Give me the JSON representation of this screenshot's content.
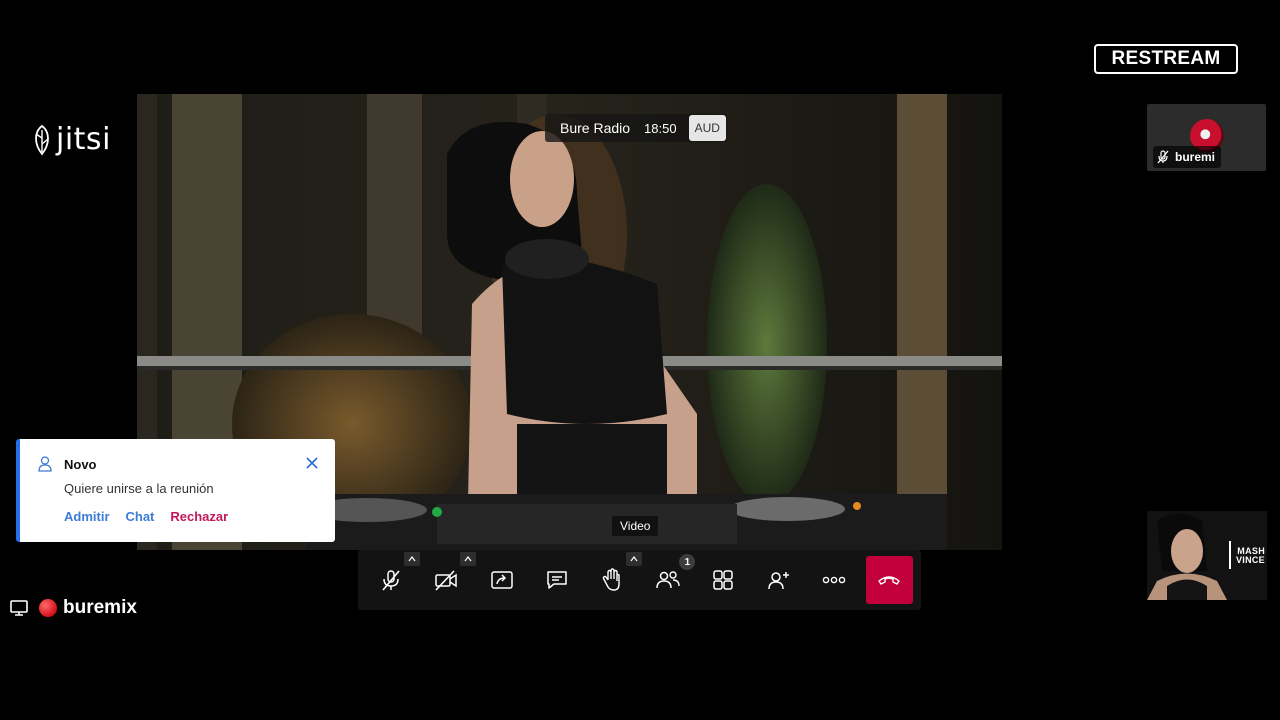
{
  "meeting": {
    "name": "Bure Radio",
    "time": "18:50",
    "audio_badge": "AUD"
  },
  "brand": {
    "jitsi_word": "jitsi",
    "restream": "RESTREAM"
  },
  "participants": {
    "buremi": {
      "name": "buremi",
      "muted": true
    },
    "vince": {
      "logo_line1": "MASH",
      "logo_line2": "VINCE"
    }
  },
  "notification": {
    "title": "Novo",
    "message": "Quiere unirse a la reunión",
    "actions": {
      "admit": "Admitir",
      "chat": "Chat",
      "reject": "Rechazar"
    }
  },
  "video_label": "Video",
  "toolbar": {
    "items": [
      {
        "name": "microphone",
        "icon": "mic-off-icon",
        "has_menu": true
      },
      {
        "name": "camera",
        "icon": "camera-off-icon",
        "has_menu": true
      },
      {
        "name": "share-screen",
        "icon": "share-screen-icon"
      },
      {
        "name": "chat",
        "icon": "chat-icon"
      },
      {
        "name": "raise-hand",
        "icon": "hand-icon",
        "has_menu": true
      },
      {
        "name": "participants",
        "icon": "participants-icon",
        "badge": "1"
      },
      {
        "name": "tile-view",
        "icon": "grid-icon"
      },
      {
        "name": "invite",
        "icon": "add-person-icon"
      },
      {
        "name": "more",
        "icon": "more-icon"
      },
      {
        "name": "hangup",
        "icon": "hangup-icon"
      }
    ],
    "participants_badge": "1",
    "hangup_color": "#c2003b"
  },
  "screen_share": {
    "label": "buremix"
  },
  "colors": {
    "accent": "#246fe5",
    "link": "#3d7bd9",
    "reject": "#c2175b"
  }
}
